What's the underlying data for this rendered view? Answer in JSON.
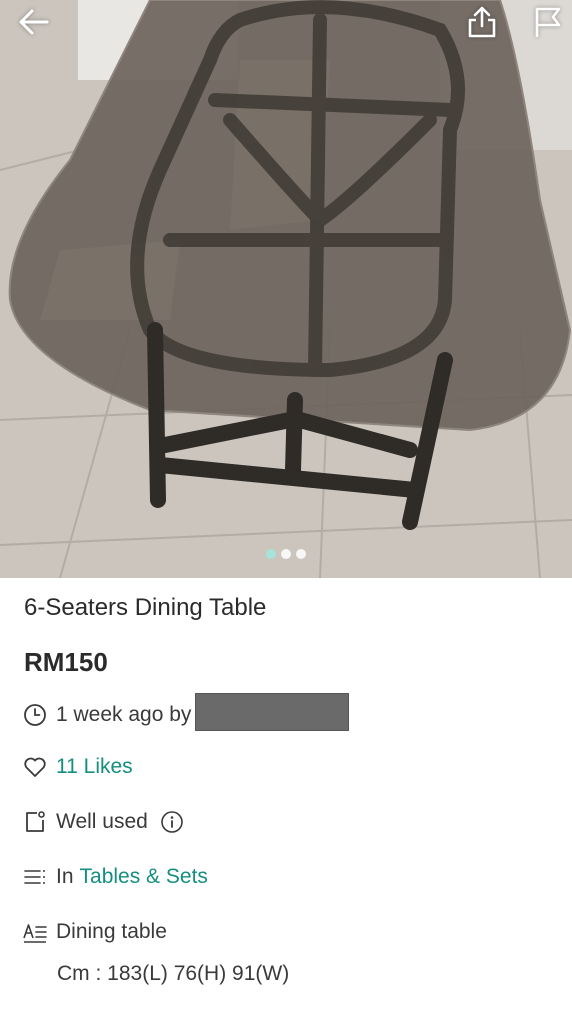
{
  "header": {
    "back_icon": "arrow-left-icon",
    "share_icon": "share-icon",
    "report_icon": "flag-icon"
  },
  "gallery": {
    "image_count": 3,
    "active_index": 0
  },
  "listing": {
    "title": "6-Seaters Dining Table",
    "price": "RM150",
    "posted": "1 week ago by",
    "likes": "11 Likes",
    "condition": "Well used",
    "category_prefix": "In",
    "category": "Tables & Sets",
    "description_line1": "Dining table",
    "description_line2": "Cm : 183(L) 76(H) 91(W)"
  },
  "colors": {
    "accent": "#148f7f",
    "active_dot": "#a7e3d9",
    "text": "#2b2b2b"
  }
}
